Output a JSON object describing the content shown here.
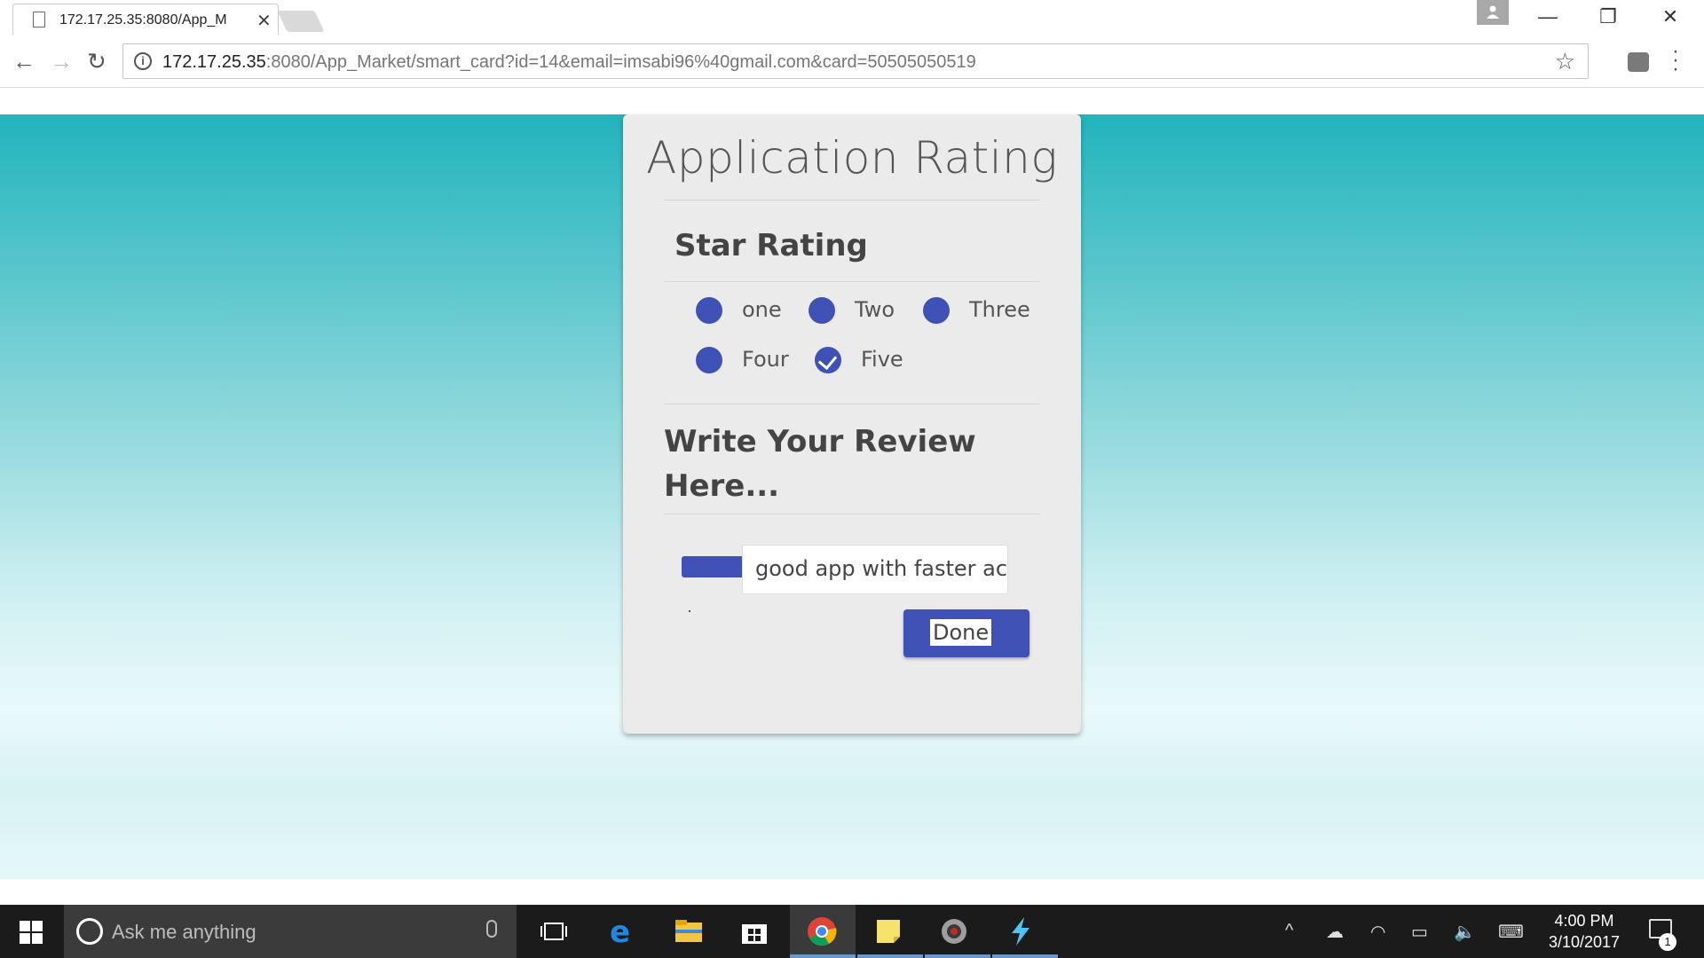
{
  "browser": {
    "tab_title": "172.17.25.35:8080/App_M",
    "url_host": "172.17.25.35",
    "url_rest": ":8080/App_Market/smart_card?id=14&email=imsabi96%40gmail.com&card=50505050519"
  },
  "card": {
    "title": "Application Rating",
    "star_section_title": "Star Rating",
    "rating_options": [
      {
        "label": "one",
        "checked": false
      },
      {
        "label": "Two",
        "checked": false
      },
      {
        "label": "Three",
        "checked": false
      },
      {
        "label": "Four",
        "checked": false
      },
      {
        "label": "Five",
        "checked": true
      }
    ],
    "review_title_line1": "Write Your Review",
    "review_title_line2": "Here...",
    "review_value": "good app with faster acce",
    "done_label": "Done"
  },
  "taskbar": {
    "search_placeholder": "Ask me anything",
    "time": "4:00 PM",
    "date": "3/10/2017",
    "notification_count": "1"
  },
  "colors": {
    "accent": "#3f51b5",
    "page_top": "#22b4bc"
  }
}
